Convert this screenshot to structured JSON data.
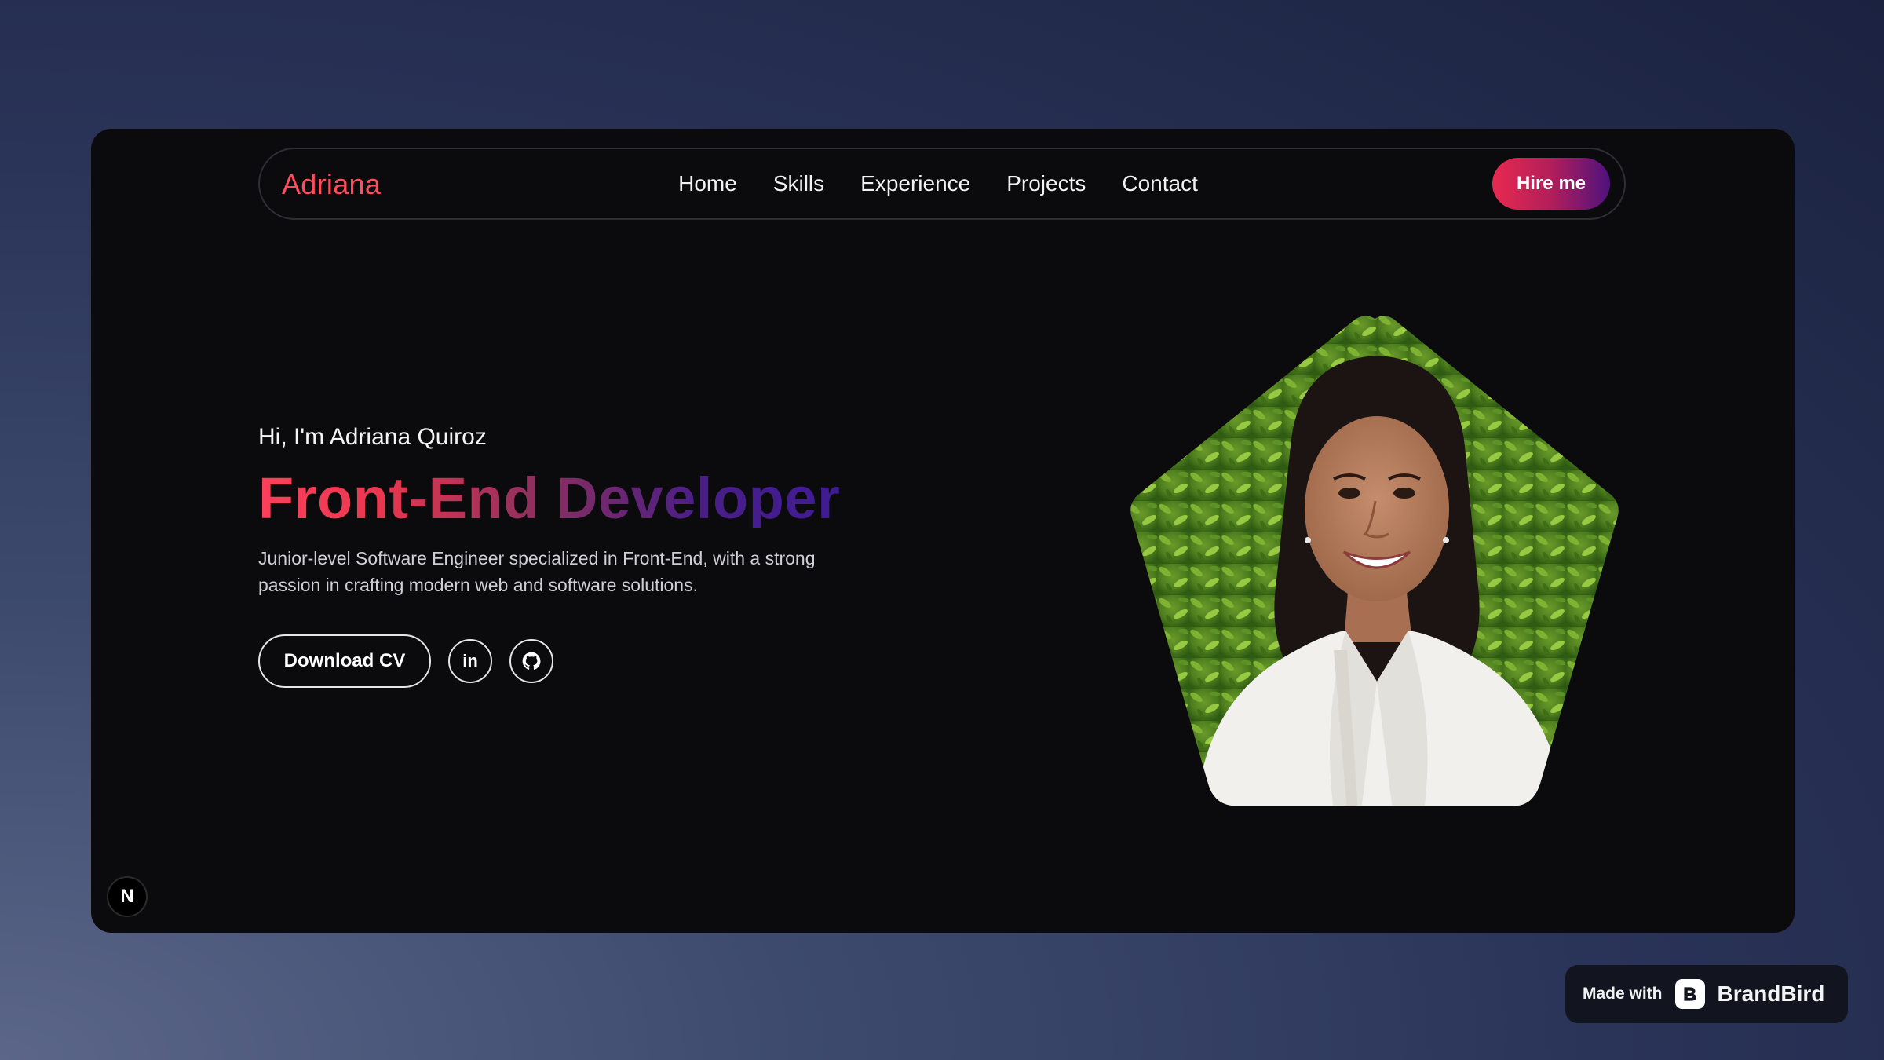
{
  "nav": {
    "brand": "Adriana",
    "links": [
      "Home",
      "Skills",
      "Experience",
      "Projects",
      "Contact"
    ],
    "hire_label": "Hire me"
  },
  "hero": {
    "greeting": "Hi, I'm Adriana Quiroz",
    "role": "Front-End Developer",
    "description": "Junior-level Software Engineer specialized in Front-End, with a strong passion in crafting modern web and software solutions.",
    "cv_label": "Download CV",
    "linkedin_label": "in",
    "github_icon": "github-icon",
    "portrait_icon": "profile-photo"
  },
  "badge": {
    "letter": "N"
  },
  "footer": {
    "made_with": "Made with",
    "brand": "BrandBird",
    "logo_icon": "brandbird-logo"
  },
  "colors": {
    "accent_start": "#e8294f",
    "accent_end": "#4d127e",
    "brand_text": "#ff4d5e",
    "window_bg": "#0b0b0d"
  }
}
